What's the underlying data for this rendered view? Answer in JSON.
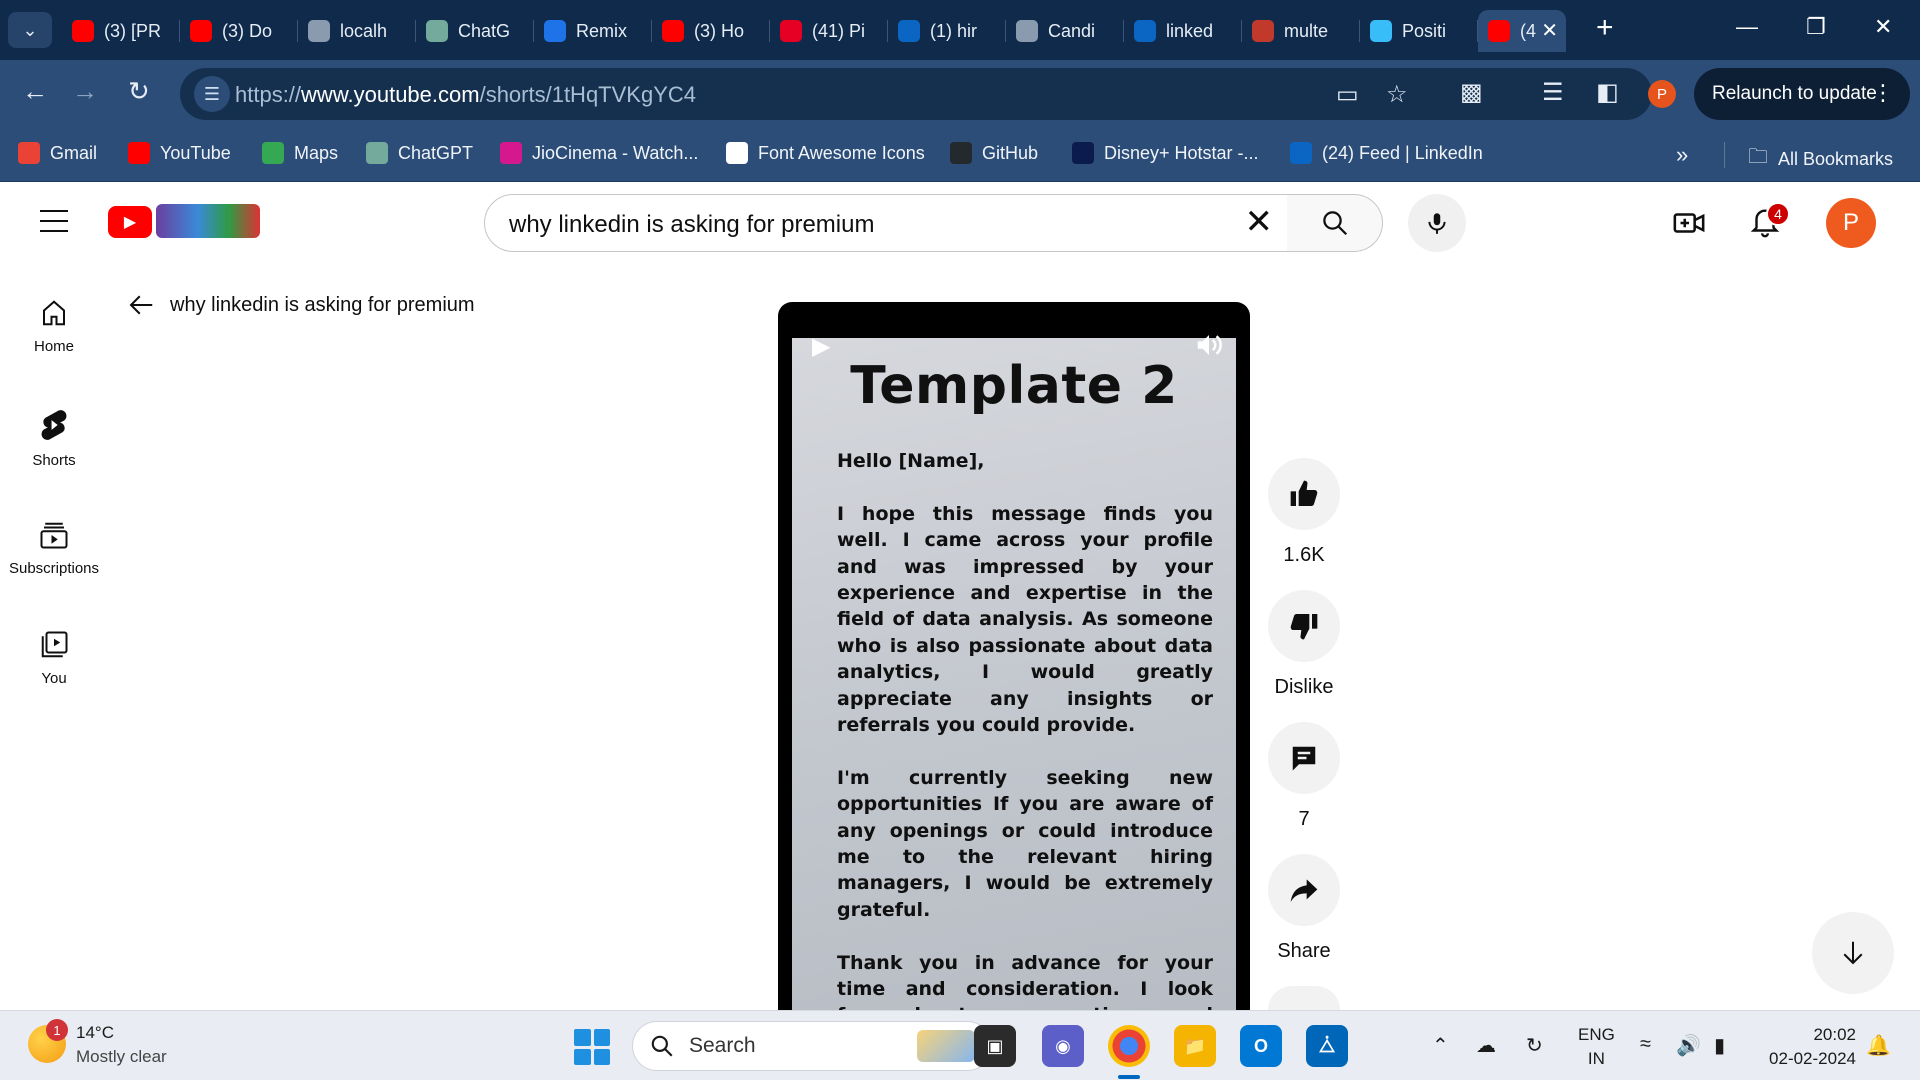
{
  "browser": {
    "tabs": [
      {
        "title": "(3) [PR",
        "icon": "youtube-icon",
        "color": "#ff0000"
      },
      {
        "title": "(3) Do",
        "icon": "youtube-icon",
        "color": "#ff0000"
      },
      {
        "title": "localh",
        "icon": "globe-icon",
        "color": "#8a9bb0"
      },
      {
        "title": "ChatG",
        "icon": "chatgpt-icon",
        "color": "#74aa9c"
      },
      {
        "title": "Remix",
        "icon": "remix-icon",
        "color": "#1e73e8"
      },
      {
        "title": "(3) Ho",
        "icon": "youtube-icon",
        "color": "#ff0000"
      },
      {
        "title": "(41) Pi",
        "icon": "pinterest-icon",
        "color": "#e60023"
      },
      {
        "title": "(1) hir",
        "icon": "linkedin-icon",
        "color": "#0a66c2"
      },
      {
        "title": "Candi",
        "icon": "globe-icon",
        "color": "#8a9bb0"
      },
      {
        "title": "linked",
        "icon": "linkedin-icon",
        "color": "#0a66c2"
      },
      {
        "title": "multe",
        "icon": "multer-icon",
        "color": "#c0392b"
      },
      {
        "title": "Positi",
        "icon": "tailwind-icon",
        "color": "#38bdf8"
      },
      {
        "title": "(4",
        "icon": "youtube-icon",
        "color": "#ff0000",
        "active": true
      }
    ],
    "url_prefix": "https://",
    "url_domain": "www.youtube.com",
    "url_path": "/shorts/1tHqTVKgYC4",
    "profile_initial": "P",
    "relaunch_label": "Relaunch to update",
    "bookmarks": [
      {
        "label": "Gmail",
        "icon": "gmail-icon",
        "color": "#ea4335"
      },
      {
        "label": "YouTube",
        "icon": "youtube-icon",
        "color": "#ff0000"
      },
      {
        "label": "Maps",
        "icon": "maps-icon",
        "color": "#34a853"
      },
      {
        "label": "ChatGPT",
        "icon": "chatgpt-icon",
        "color": "#74aa9c"
      },
      {
        "label": "JioCinema - Watch...",
        "icon": "jiocinema-icon",
        "color": "#d6188f"
      },
      {
        "label": "Font Awesome Icons",
        "icon": "flag-icon",
        "color": "#ffffff"
      },
      {
        "label": "GitHub",
        "icon": "github-icon",
        "color": "#24292e"
      },
      {
        "label": "Disney+ Hotstar -...",
        "icon": "hotstar-icon",
        "color": "#0c1b4d"
      },
      {
        "label": "(24) Feed | LinkedIn",
        "icon": "linkedin-icon",
        "color": "#0a66c2"
      }
    ],
    "all_bookmarks_label": "All Bookmarks"
  },
  "youtube": {
    "search_query": "why linkedin is asking for premium",
    "notification_count": "4",
    "avatar_initial": "P",
    "sidebar": [
      {
        "label": "Home",
        "icon": "home-icon"
      },
      {
        "label": "Shorts",
        "icon": "shorts-icon"
      },
      {
        "label": "Subscriptions",
        "icon": "subscriptions-icon"
      },
      {
        "label": "You",
        "icon": "you-icon"
      }
    ],
    "back_title": "why linkedin is asking for premium",
    "short": {
      "title": "Template 2",
      "paragraphs": [
        "Hello [Name],",
        "I hope this message finds you well. I came across your profile and was impressed by your experience and expertise in the field of data analysis. As someone who is also passionate about data analytics, I would greatly appreciate any insights or referrals you could provide.",
        "I'm currently seeking new opportunities If you are aware of any openings or could introduce me to the relevant hiring managers, I would be extremely grateful.",
        "Thank you in advance for your time and consideration. I look forward to connecting and learning from your valuable experience."
      ]
    },
    "actions": {
      "like": "1.6K",
      "dislike": "Dislike",
      "comments": "7",
      "share": "Share"
    }
  },
  "taskbar": {
    "weather_temp": "14°C",
    "weather_desc": "Mostly clear",
    "weather_badge": "1",
    "search_label": "Search",
    "lang_top": "ENG",
    "lang_bottom": "IN",
    "time": "20:02",
    "date": "02-02-2024"
  }
}
